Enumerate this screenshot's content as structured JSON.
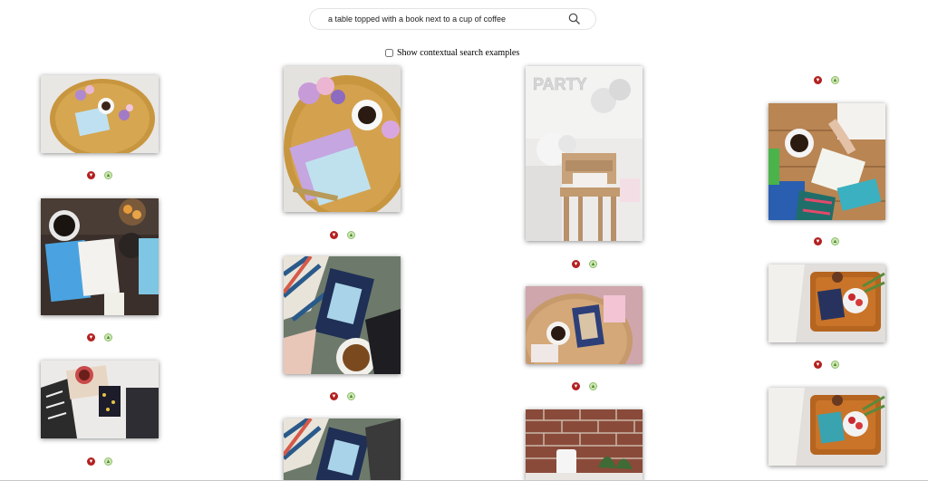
{
  "search": {
    "value": "a table topped with a book next to a cup of coffee",
    "icon": "search-icon"
  },
  "contextual": {
    "label": "Show contextual search examples",
    "checked": false
  },
  "results": [
    {
      "name": "result-tray-flowers-card"
    },
    {
      "name": "result-flowers-card-closeup"
    },
    {
      "name": "result-party-highchair"
    },
    {
      "name": "result-writing-card-coffee"
    },
    {
      "name": "result-writing-card-fruit"
    },
    {
      "name": "result-card-reading-couch"
    },
    {
      "name": "result-card-round-table"
    },
    {
      "name": "result-breakfast-tray-bed"
    },
    {
      "name": "result-tea-cup-bed"
    },
    {
      "name": "result-card-couch-partial"
    },
    {
      "name": "result-brick-candle"
    },
    {
      "name": "result-breakfast-tray-bed-2"
    }
  ],
  "feedback": {
    "dislike_icon": "thumbs-down-icon",
    "like_icon": "thumbs-up-icon"
  }
}
